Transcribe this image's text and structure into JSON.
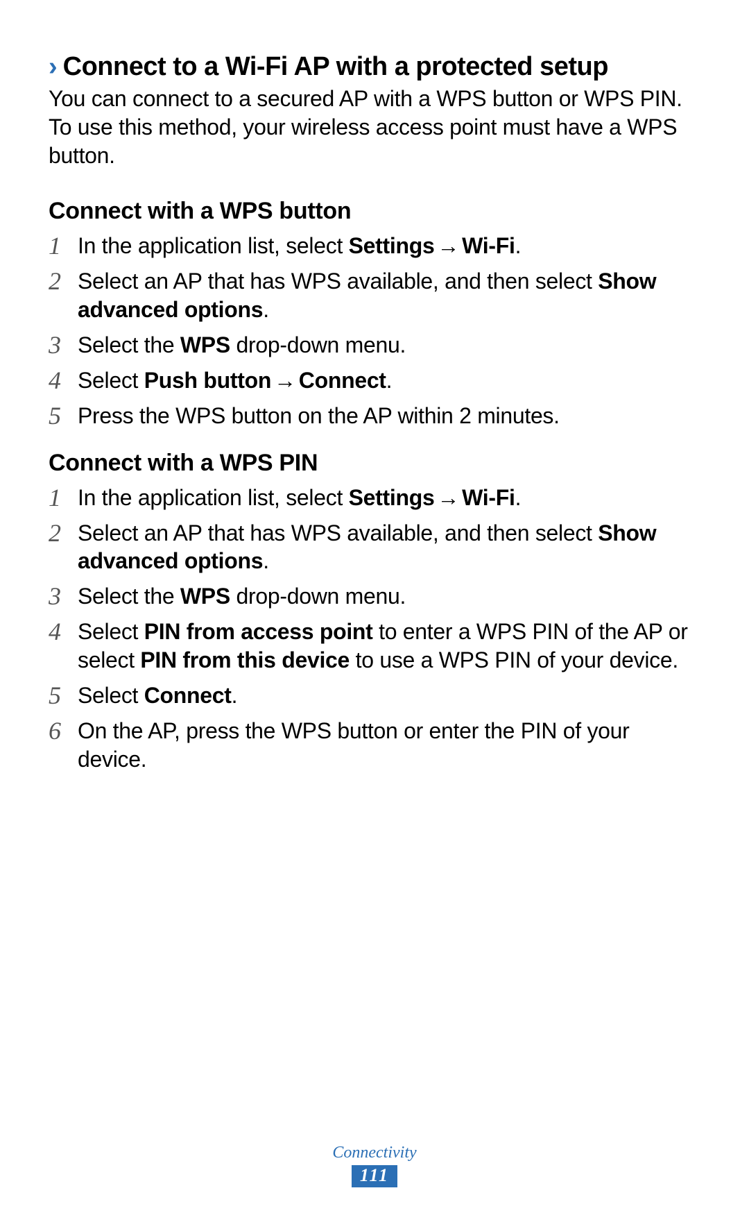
{
  "section": {
    "chevron": "›",
    "title": "Connect to a Wi-Fi AP with a protected setup",
    "intro": "You can connect to a secured AP with a WPS button or WPS PIN. To use this method, your wireless access point must have a WPS button."
  },
  "wps_button": {
    "heading": "Connect with a WPS button",
    "steps": {
      "s1_a": "In the application list, select ",
      "s1_b": "Settings",
      "s1_arrow": " → ",
      "s1_c": "Wi-Fi",
      "s1_d": ".",
      "s2_a": "Select an AP that has WPS available, and then select ",
      "s2_b": "Show advanced options",
      "s2_c": ".",
      "s3_a": "Select the ",
      "s3_b": "WPS",
      "s3_c": " drop-down menu.",
      "s4_a": "Select ",
      "s4_b": "Push button",
      "s4_arrow": " → ",
      "s4_c": "Connect",
      "s4_d": ".",
      "s5_a": "Press the WPS button on the AP within 2 minutes."
    }
  },
  "wps_pin": {
    "heading": "Connect with a WPS PIN",
    "steps": {
      "s1_a": "In the application list, select ",
      "s1_b": "Settings",
      "s1_arrow": " → ",
      "s1_c": "Wi-Fi",
      "s1_d": ".",
      "s2_a": "Select an AP that has WPS available, and then select ",
      "s2_b": "Show advanced options",
      "s2_c": ".",
      "s3_a": "Select the ",
      "s3_b": "WPS",
      "s3_c": " drop-down menu.",
      "s4_a": "Select ",
      "s4_b": "PIN from access point",
      "s4_c": " to enter a WPS PIN of the AP or select ",
      "s4_d": "PIN from this device",
      "s4_e": " to use a WPS PIN of your device.",
      "s5_a": "Select ",
      "s5_b": "Connect",
      "s5_c": ".",
      "s6_a": "On the AP, press the WPS button or enter the PIN of your device."
    }
  },
  "numbers": {
    "n1": "1",
    "n2": "2",
    "n3": "3",
    "n4": "4",
    "n5": "5",
    "n6": "6"
  },
  "footer": {
    "label": "Connectivity",
    "page": "111"
  }
}
